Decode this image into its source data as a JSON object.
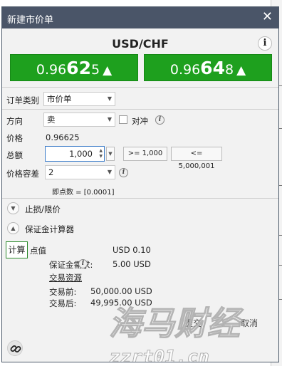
{
  "dialog": {
    "title": "新建市价单",
    "close_glyph": "✕"
  },
  "symbol": "USD/CHF",
  "info_glyph": "i",
  "quotes": [
    {
      "side": "sell",
      "small": "0.96",
      "big": "62",
      "pip": "5",
      "arrow": "▲",
      "color": "#1ea01e"
    },
    {
      "side": "buy",
      "small": "0.96",
      "big": "64",
      "pip": "8",
      "arrow": "▲",
      "color": "#1ea01e"
    }
  ],
  "order": {
    "type_label": "订单类别",
    "type_value": "市价单",
    "direction_label": "方向",
    "direction_value": "卖",
    "hedge_label": "对冲",
    "price_label": "价格",
    "price_value": "0.96625",
    "amount_label": "总额",
    "amount_value": "1,000",
    "min_label": ">= 1,000",
    "max_label": "<= 5,000,001",
    "slippage_label": "价格容差",
    "slippage_value": "2",
    "pip_note": "即点数 = [0.0001]"
  },
  "sections": {
    "stop_limit": "止损/限价",
    "margin_calc": "保证金计算器"
  },
  "calc": {
    "button": "计算",
    "pip_value_label": "点值",
    "pip_value": "USD 0.10",
    "margin_label": "保证金需求:",
    "margin_value": "5.00 USD",
    "resources_label": "交易资源",
    "before_label": "交易前:",
    "before_value": "50,000.00 USD",
    "after_label": "交易后:",
    "after_value": "49,995.00 USD"
  },
  "footer": {
    "submit": "提交",
    "cancel": "取消"
  },
  "watermark": {
    "line1": "海马财经",
    "line2": "zzrt01.cn"
  },
  "colors": {
    "titlebar": "#4a5568",
    "quote_green": "#1ea01e",
    "input_focus": "#3d7dc9"
  }
}
